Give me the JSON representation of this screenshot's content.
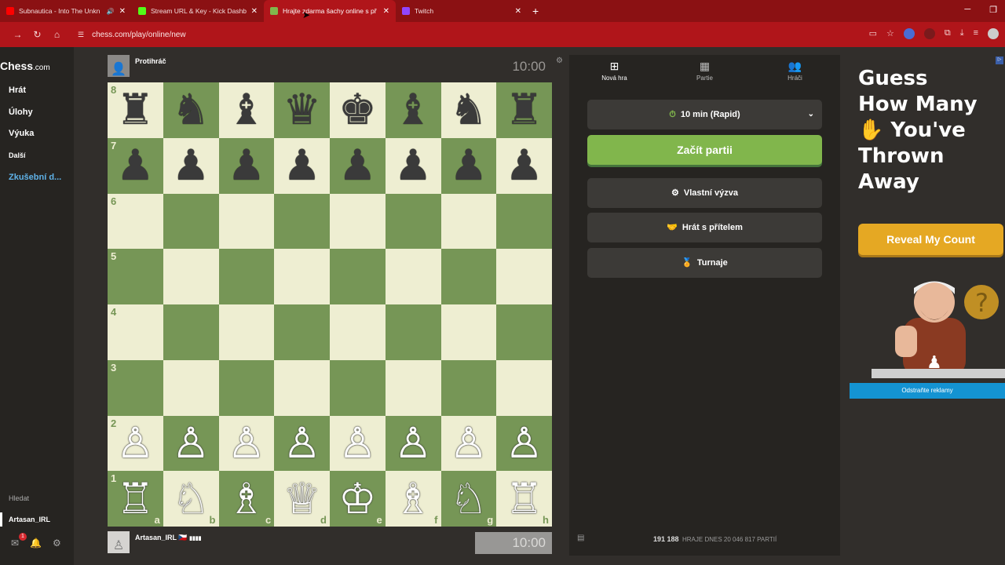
{
  "browser": {
    "tabs": [
      {
        "title": "Subnautica - Into The Unkn",
        "color": "#ff0000",
        "audio": true,
        "active": false
      },
      {
        "title": "Stream URL & Key - Kick Dashb",
        "color": "#53fc18",
        "audio": false,
        "active": false
      },
      {
        "title": "Hrajte zdarma šachy online s př",
        "color": "#81b64c",
        "audio": false,
        "active": true
      },
      {
        "title": "Twitch",
        "color": "#9146ff",
        "audio": false,
        "active": false
      }
    ],
    "url": "chess.com/play/online/new"
  },
  "sidebar": {
    "logo_main": "Chess",
    "logo_suffix": ".com",
    "items": [
      {
        "label": "Hrát"
      },
      {
        "label": "Úlohy"
      },
      {
        "label": "Výuka"
      },
      {
        "label": "Další"
      },
      {
        "label": "Zkušební d..."
      }
    ],
    "search_label": "Hledat",
    "username": "Artasan_IRL",
    "notif_count": "1"
  },
  "game": {
    "opponent": "Protihráč",
    "opponent_clock": "10:00",
    "player": "Artasan_IRL",
    "player_flag": "🇨🇿",
    "player_bars": "▮▮▮▮",
    "player_clock": "10:00",
    "board": [
      [
        "♜",
        "♞",
        "♝",
        "♛",
        "♚",
        "♝",
        "♞",
        "♜"
      ],
      [
        "♟",
        "♟",
        "♟",
        "♟",
        "♟",
        "♟",
        "♟",
        "♟"
      ],
      [
        "",
        "",
        "",
        "",
        "",
        "",
        "",
        ""
      ],
      [
        "",
        "",
        "",
        "",
        "",
        "",
        "",
        ""
      ],
      [
        "",
        "",
        "",
        "",
        "",
        "",
        "",
        ""
      ],
      [
        "",
        "",
        "",
        "",
        "",
        "",
        "",
        ""
      ],
      [
        "♙",
        "♙",
        "♙",
        "♙",
        "♙",
        "♙",
        "♙",
        "♙"
      ],
      [
        "♖",
        "♘",
        "♗",
        "♕",
        "♔",
        "♗",
        "♘",
        "♖"
      ]
    ],
    "ranks": [
      "8",
      "7",
      "6",
      "5",
      "4",
      "3",
      "2",
      "1"
    ],
    "files": [
      "a",
      "b",
      "c",
      "d",
      "e",
      "f",
      "g",
      "h"
    ]
  },
  "panel": {
    "tabs": [
      {
        "label": "Nová hra",
        "icon": "⊞"
      },
      {
        "label": "Partie",
        "icon": "▦"
      },
      {
        "label": "Hráči",
        "icon": "👥"
      }
    ],
    "time_control": "10 min (Rapid)",
    "start_button": "Začít partii",
    "custom_challenge": "Vlastní výzva",
    "play_friend": "Hrát s přítelem",
    "tournaments": "Turnaje",
    "players_count": "191 188",
    "stats_text": "HRAJE DNES 20 046 817 PARTIÍ"
  },
  "ad": {
    "headline_1": "Guess",
    "headline_2": "How Many",
    "headline_3": "✋ You've",
    "headline_4": "Thrown",
    "headline_5": "Away",
    "cta": "Reveal My Count",
    "remove_ads": "Odstraňte reklamy"
  }
}
